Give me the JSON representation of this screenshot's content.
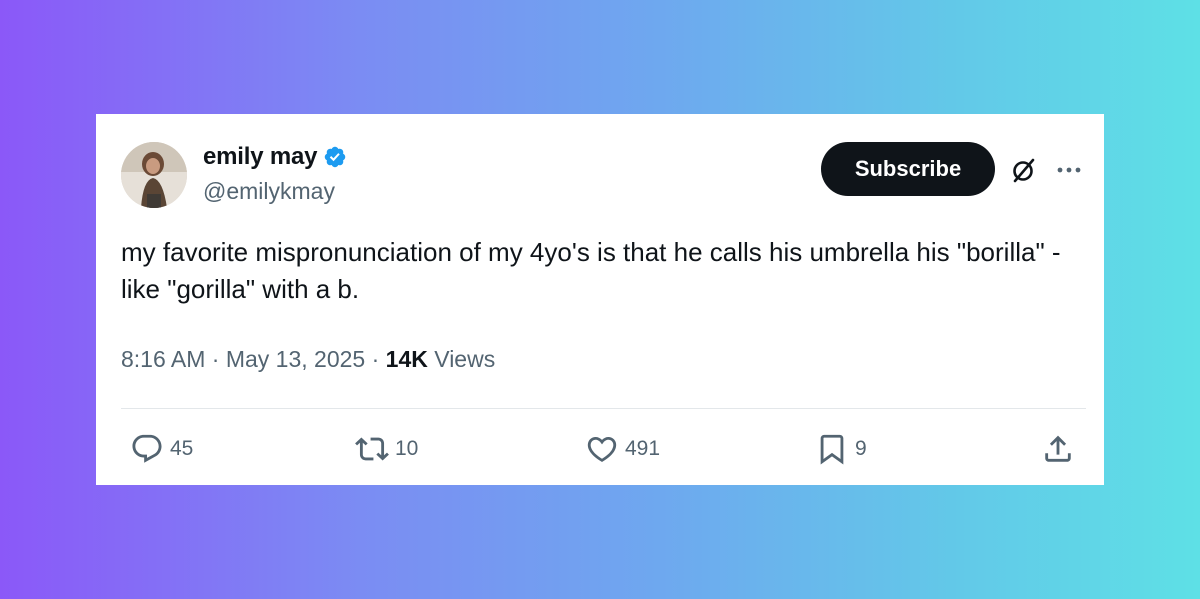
{
  "author": {
    "display_name": "emily may",
    "handle": "@emilykmay",
    "verified": true
  },
  "header": {
    "subscribe_label": "Subscribe"
  },
  "tweet": {
    "text": "my favorite mispronunciation of my 4yo's is that he calls his umbrella his \"borilla\" - like \"gorilla\" with a b.",
    "time": "8:16 AM",
    "date": "May 13, 2025",
    "views_count": "14K",
    "views_label": "Views"
  },
  "actions": {
    "replies": "45",
    "reposts": "10",
    "likes": "491",
    "bookmarks": "9"
  },
  "colors": {
    "text_primary": "#0f1419",
    "text_secondary": "#536471",
    "verified_blue": "#1d9bf0",
    "button_dark": "#0f1419"
  }
}
